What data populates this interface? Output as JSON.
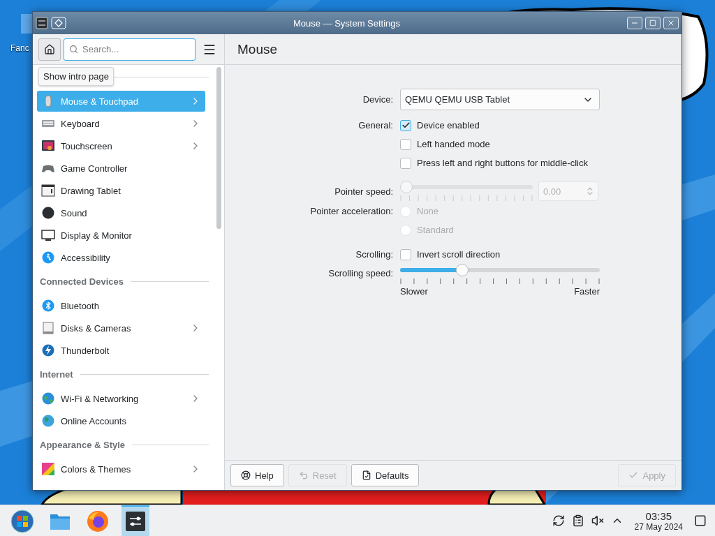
{
  "desktop": {
    "icon_label": "Fanc"
  },
  "window": {
    "title": "Mouse — System Settings"
  },
  "header": {
    "search": {
      "placeholder": "Search..."
    },
    "page_title": "Mouse",
    "tooltip": "Show intro page"
  },
  "sidebar": {
    "groups": [
      {
        "items": [
          {
            "label": "Mouse & Touchpad",
            "selected": true,
            "expandable": true
          },
          {
            "label": "Keyboard",
            "selected": false,
            "expandable": true
          },
          {
            "label": "Touchscreen",
            "selected": false,
            "expandable": true
          },
          {
            "label": "Game Controller",
            "selected": false,
            "expandable": false
          },
          {
            "label": "Drawing Tablet",
            "selected": false,
            "expandable": false
          },
          {
            "label": "Sound",
            "selected": false,
            "expandable": false
          },
          {
            "label": "Display & Monitor",
            "selected": false,
            "expandable": false
          },
          {
            "label": "Accessibility",
            "selected": false,
            "expandable": false
          }
        ]
      },
      {
        "heading": "Connected Devices",
        "items": [
          {
            "label": "Bluetooth",
            "selected": false,
            "expandable": false
          },
          {
            "label": "Disks & Cameras",
            "selected": false,
            "expandable": true
          },
          {
            "label": "Thunderbolt",
            "selected": false,
            "expandable": false
          }
        ]
      },
      {
        "heading": "Internet",
        "items": [
          {
            "label": "Wi-Fi & Networking",
            "selected": false,
            "expandable": true
          },
          {
            "label": "Online Accounts",
            "selected": false,
            "expandable": false
          }
        ]
      },
      {
        "heading": "Appearance & Style",
        "items": [
          {
            "label": "Colors & Themes",
            "selected": false,
            "expandable": true
          }
        ]
      }
    ]
  },
  "form": {
    "device": {
      "label": "Device:",
      "value": "QEMU QEMU USB Tablet"
    },
    "general": {
      "label": "General:",
      "options": [
        {
          "label": "Device enabled",
          "checked": true
        },
        {
          "label": "Left handed mode",
          "checked": false
        },
        {
          "label": "Press left and right buttons for middle-click",
          "checked": false
        }
      ]
    },
    "pointer_speed": {
      "label": "Pointer speed:",
      "level": 0,
      "value": "0.00",
      "disabled": true
    },
    "pointer_acceleration": {
      "label": "Pointer acceleration:",
      "disabled": true,
      "options": [
        {
          "label": "None",
          "selected": false
        },
        {
          "label": "Standard",
          "selected": false
        }
      ]
    },
    "scrolling": {
      "label": "Scrolling:",
      "options": [
        {
          "label": "Invert scroll direction",
          "checked": false
        }
      ]
    },
    "scrolling_speed": {
      "label": "Scrolling speed:",
      "level": 0.3,
      "disabled": false,
      "min_label": "Slower",
      "max_label": "Faster"
    }
  },
  "footer": {
    "left_buttons": [
      {
        "label": "Help",
        "kind": "help",
        "disabled": false
      },
      {
        "label": "Reset",
        "kind": "reset",
        "disabled": true
      },
      {
        "label": "Defaults",
        "kind": "defaults",
        "disabled": false
      }
    ],
    "right_buttons": [
      {
        "label": "Apply",
        "kind": "apply",
        "disabled": true
      }
    ]
  },
  "taskbar": {
    "apps": [
      {
        "selected": false
      },
      {
        "selected": false
      },
      {
        "selected": false
      },
      {
        "selected": true
      }
    ],
    "clock": {
      "time": "03:35",
      "date": "27 May 2024"
    }
  }
}
